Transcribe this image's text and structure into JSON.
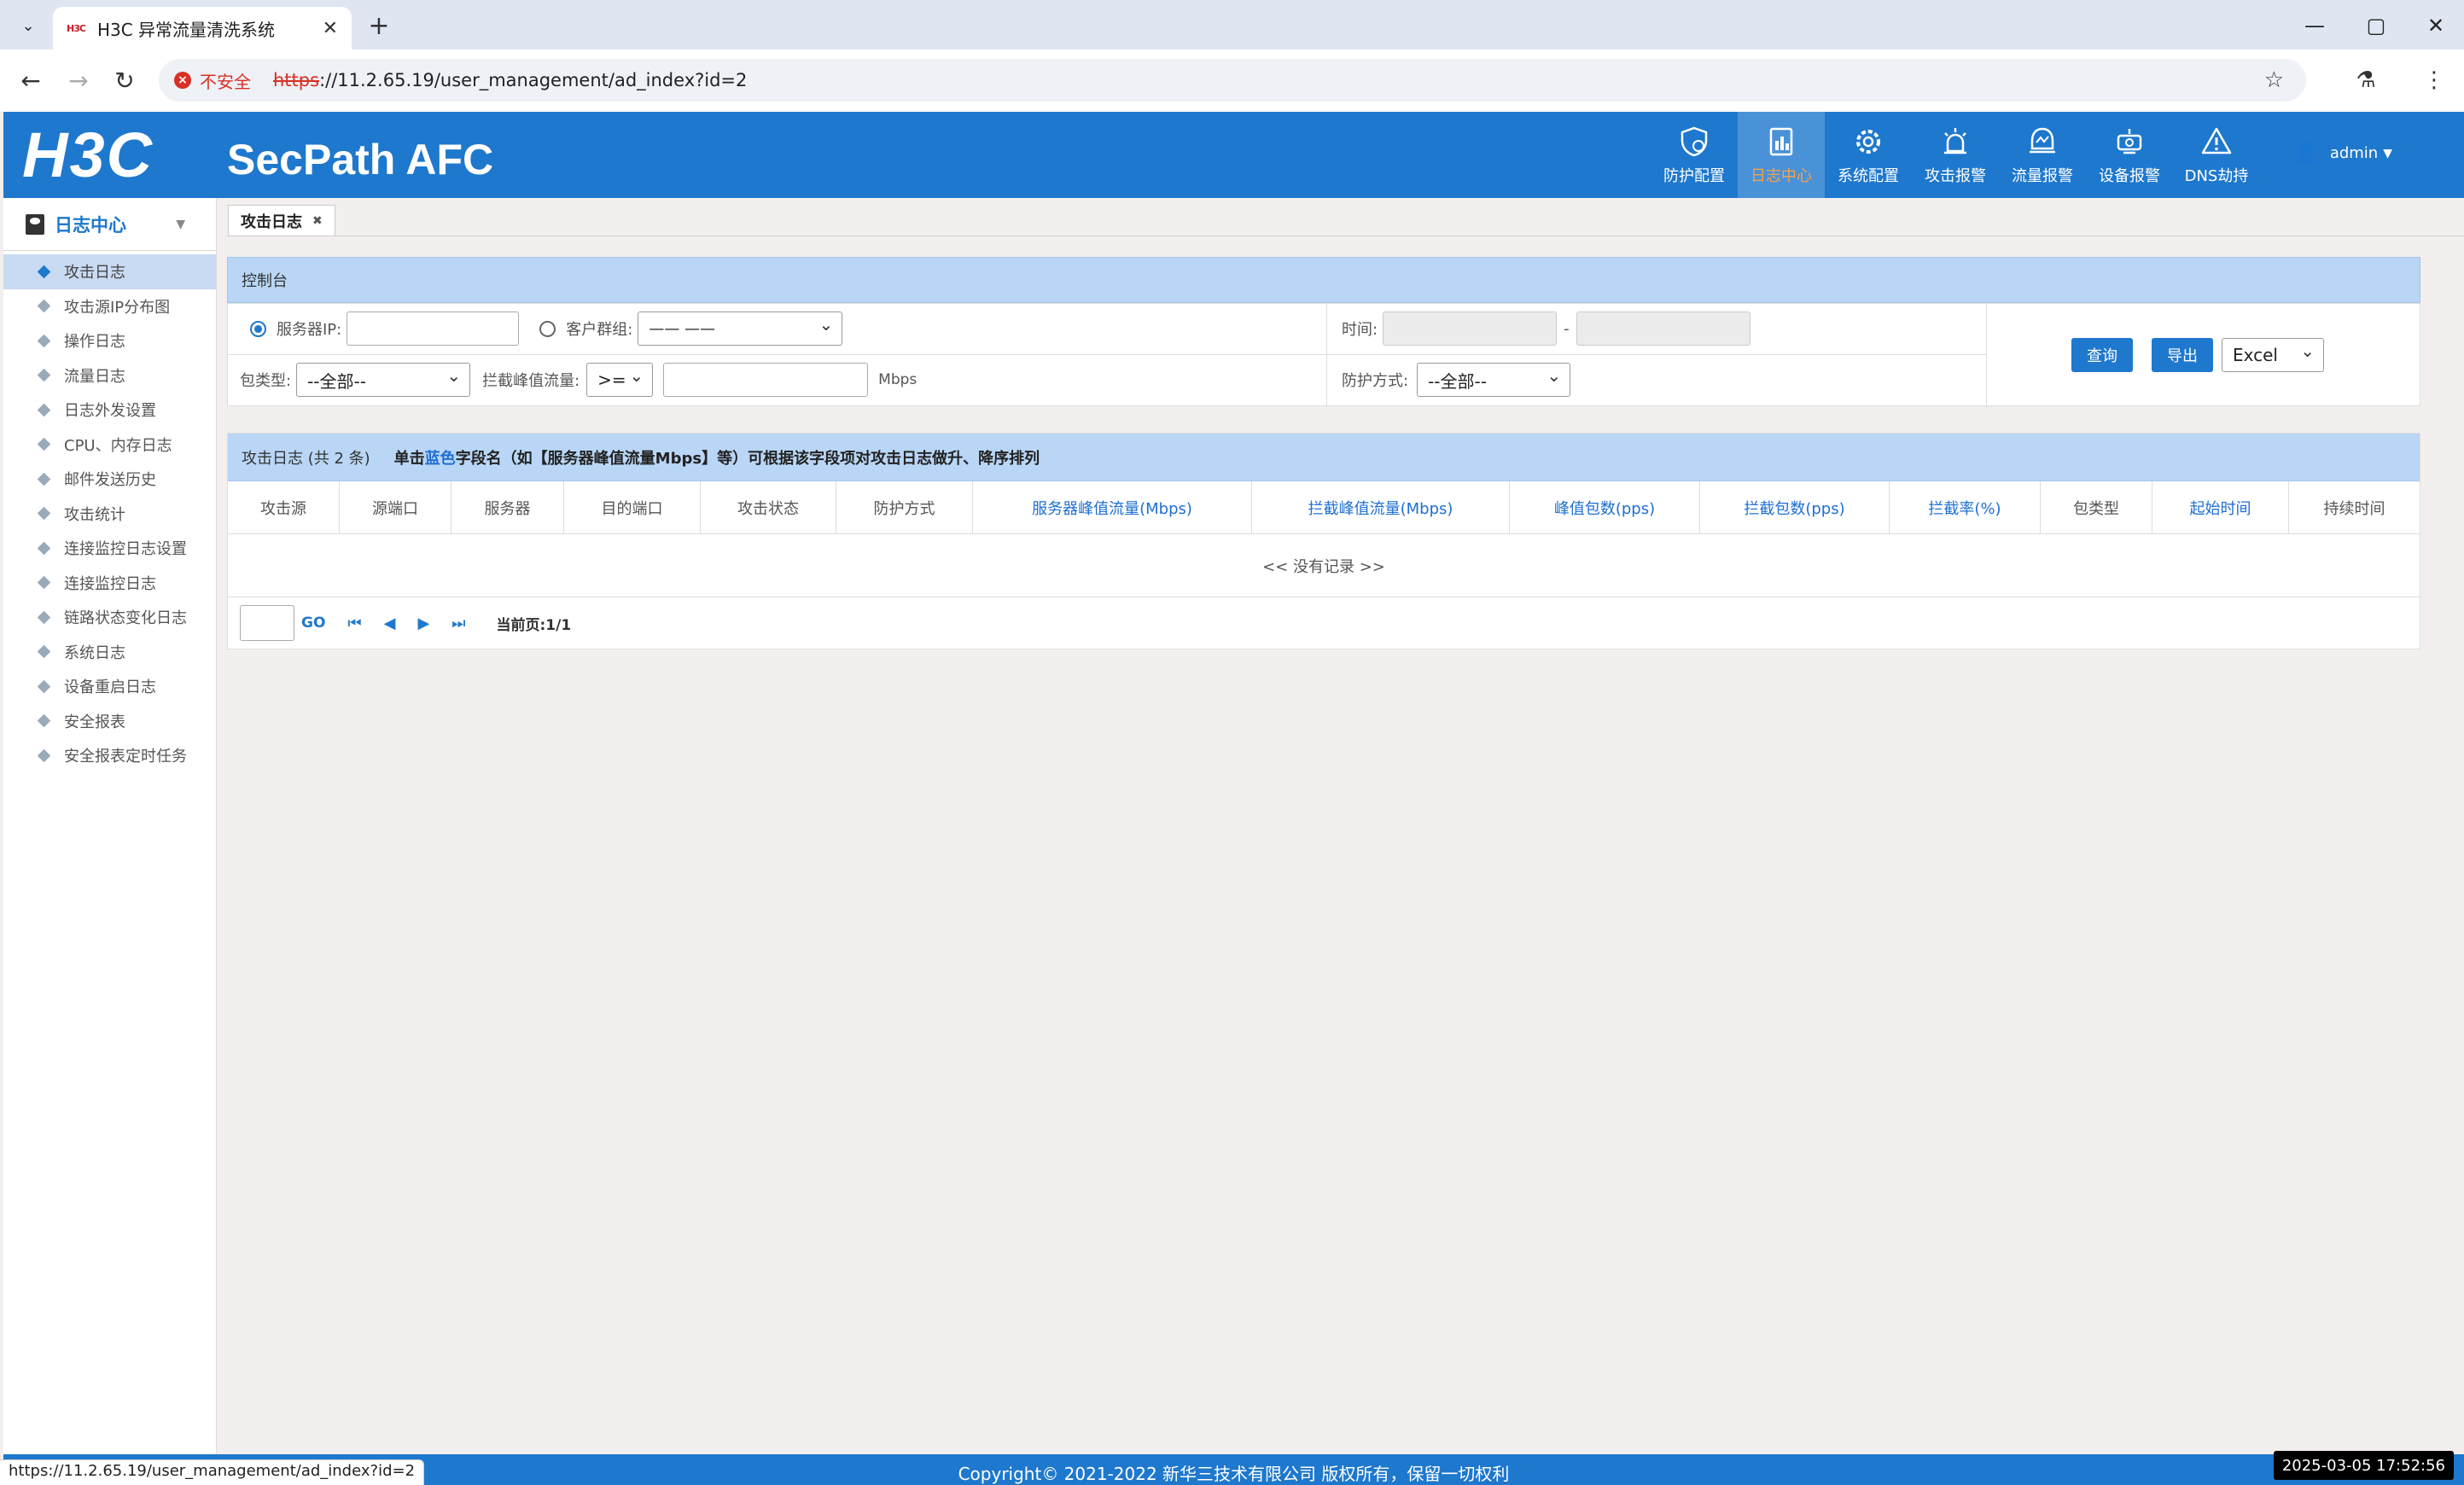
{
  "browser": {
    "tab_title": "H3C 异常流量清洗系统",
    "favicon_text": "H3C",
    "insecure_label": "不安全",
    "url_scheme": "https",
    "url_rest": "://11.2.65.19/user_management/ad_index?id=2"
  },
  "header": {
    "logo": "H3C",
    "product": "SecPath AFC",
    "nav": [
      {
        "label": "防护配置",
        "icon": "shield-icon"
      },
      {
        "label": "日志中心",
        "icon": "log-icon"
      },
      {
        "label": "系统配置",
        "icon": "gear-icon"
      },
      {
        "label": "攻击报警",
        "icon": "alarm-icon"
      },
      {
        "label": "流量报警",
        "icon": "traffic-alarm-icon"
      },
      {
        "label": "设备报警",
        "icon": "device-alarm-icon"
      },
      {
        "label": "DNS劫持",
        "icon": "warning-icon"
      }
    ],
    "active_nav": 1,
    "user": "admin"
  },
  "sidebar": {
    "title": "日志中心",
    "items": [
      "攻击日志",
      "攻击源IP分布图",
      "操作日志",
      "流量日志",
      "日志外发设置",
      "CPU、内存日志",
      "邮件发送历史",
      "攻击统计",
      "连接监控日志设置",
      "连接监控日志",
      "链路状态变化日志",
      "系统日志",
      "设备重启日志",
      "安全报表",
      "安全报表定时任务"
    ],
    "active": 0
  },
  "content": {
    "tab": "攻击日志",
    "console": {
      "title": "控制台",
      "server_ip_label": "服务器IP:",
      "client_group_label": "客户群组:",
      "client_group_value": "—— ——",
      "time_label": "时间:",
      "time_sep": "-",
      "packet_type_label": "包类型:",
      "packet_type_value": "--全部--",
      "block_peak_label": "拦截峰值流量:",
      "operator_value": ">=",
      "unit": "Mbps",
      "protect_label": "防护方式:",
      "protect_value": "--全部--",
      "query_button": "查询",
      "export_button": "导出",
      "export_format": "Excel"
    },
    "log": {
      "title": "攻击日志 (共 2 条)",
      "hint_pre": "单击",
      "hint_blue": "蓝色",
      "hint_post": "字段名（如【服务器峰值流量Mbps】等）可根据该字段项对攻击日志做升、降序排列",
      "columns": [
        {
          "label": "攻击源",
          "sortable": false
        },
        {
          "label": "源端口",
          "sortable": false
        },
        {
          "label": "服务器",
          "sortable": false
        },
        {
          "label": "目的端口",
          "sortable": false
        },
        {
          "label": "攻击状态",
          "sortable": false
        },
        {
          "label": "防护方式",
          "sortable": false
        },
        {
          "label": "服务器峰值流量(Mbps)",
          "sortable": true
        },
        {
          "label": "拦截峰值流量(Mbps)",
          "sortable": true
        },
        {
          "label": "峰值包数(pps)",
          "sortable": true
        },
        {
          "label": "拦截包数(pps)",
          "sortable": true
        },
        {
          "label": "拦截率(%)",
          "sortable": true
        },
        {
          "label": "包类型",
          "sortable": false
        },
        {
          "label": "起始时间",
          "sortable": true
        },
        {
          "label": "持续时间",
          "sortable": false
        }
      ],
      "empty_text": "<< 没有记录 >>",
      "go_label": "GO",
      "page_info": "当前页:1/1"
    }
  },
  "footer": {
    "copyright": "Copyright© 2021-2022 新华三技术有限公司 版权所有，保留一切权利"
  },
  "status": {
    "link_url": "https://11.2.65.19/user_management/ad_index?id=2",
    "clock": "2025-03-05 17:52:56"
  }
}
